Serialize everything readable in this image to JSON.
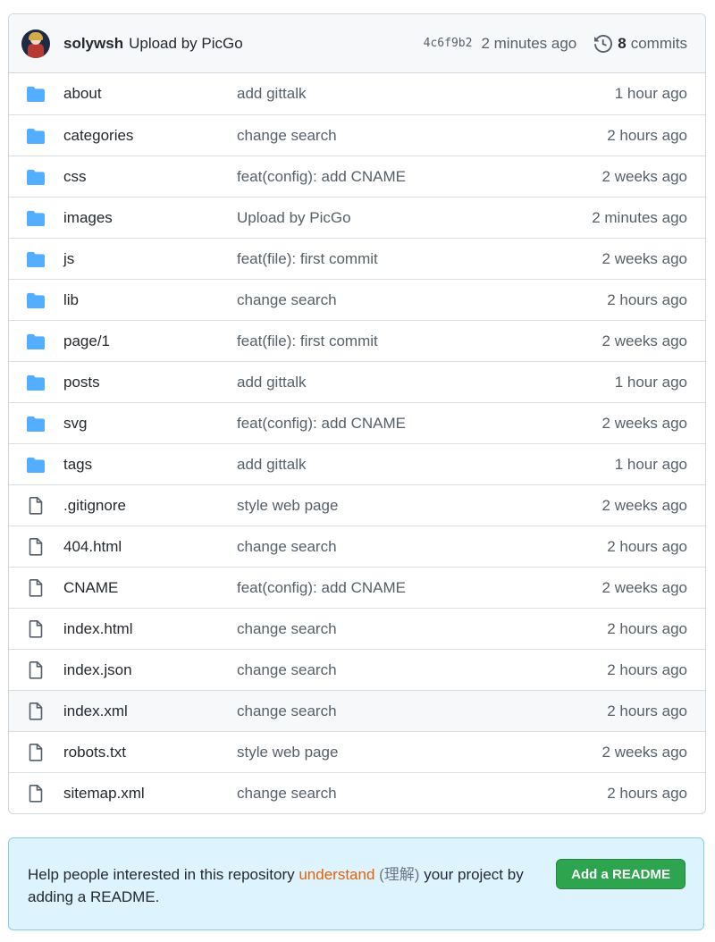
{
  "latest_commit": {
    "author": "solywsh",
    "message": "Upload by PicGo",
    "sha": "4c6f9b2",
    "age": "2 minutes ago",
    "commit_count": "8",
    "commits_label": "commits"
  },
  "files": [
    {
      "type": "dir",
      "icon": "folder-icon",
      "name": "about",
      "message": "add gittalk",
      "age": "1 hour ago"
    },
    {
      "type": "dir",
      "icon": "folder-icon",
      "name": "categories",
      "message": "change search",
      "age": "2 hours ago"
    },
    {
      "type": "dir",
      "icon": "folder-icon",
      "name": "css",
      "message": "feat(config): add CNAME",
      "age": "2 weeks ago"
    },
    {
      "type": "dir",
      "icon": "folder-icon",
      "name": "images",
      "message": "Upload by PicGo",
      "age": "2 minutes ago"
    },
    {
      "type": "dir",
      "icon": "folder-icon",
      "name": "js",
      "message": "feat(file): first commit",
      "age": "2 weeks ago"
    },
    {
      "type": "dir",
      "icon": "folder-icon",
      "name": "lib",
      "message": "change search",
      "age": "2 hours ago"
    },
    {
      "type": "dir",
      "icon": "folder-icon",
      "name": "page/1",
      "message": "feat(file): first commit",
      "age": "2 weeks ago"
    },
    {
      "type": "dir",
      "icon": "folder-icon",
      "name": "posts",
      "message": "add gittalk",
      "age": "1 hour ago"
    },
    {
      "type": "dir",
      "icon": "folder-icon",
      "name": "svg",
      "message": "feat(config): add CNAME",
      "age": "2 weeks ago"
    },
    {
      "type": "dir",
      "icon": "folder-icon",
      "name": "tags",
      "message": "add gittalk",
      "age": "1 hour ago"
    },
    {
      "type": "file",
      "icon": "file-icon",
      "name": ".gitignore",
      "message": "style web page",
      "age": "2 weeks ago"
    },
    {
      "type": "file",
      "icon": "file-icon",
      "name": "404.html",
      "message": "change search",
      "age": "2 hours ago"
    },
    {
      "type": "file",
      "icon": "file-icon",
      "name": "CNAME",
      "message": "feat(config): add CNAME",
      "age": "2 weeks ago"
    },
    {
      "type": "file",
      "icon": "file-icon",
      "name": "index.html",
      "message": "change search",
      "age": "2 hours ago"
    },
    {
      "type": "file",
      "icon": "file-icon",
      "name": "index.json",
      "message": "change search",
      "age": "2 hours ago"
    },
    {
      "type": "file",
      "icon": "file-icon",
      "name": "index.xml",
      "message": "change search",
      "age": "2 hours ago",
      "hovered": true
    },
    {
      "type": "file",
      "icon": "file-icon",
      "name": "robots.txt",
      "message": "style web page",
      "age": "2 weeks ago"
    },
    {
      "type": "file",
      "icon": "file-icon",
      "name": "sitemap.xml",
      "message": "change search",
      "age": "2 hours ago"
    }
  ],
  "readme_prompt": {
    "text_before": "Help people interested in this repository ",
    "highlight": "understand",
    "gloss": " (理解)",
    "text_after": " your project by adding a README.",
    "button_label": "Add a README"
  },
  "colors": {
    "folder": "#54aeff",
    "file_icon": "#57606a",
    "button": "#2da44e",
    "readme_bg": "#ddf4ff",
    "highlight": "#e36209"
  }
}
